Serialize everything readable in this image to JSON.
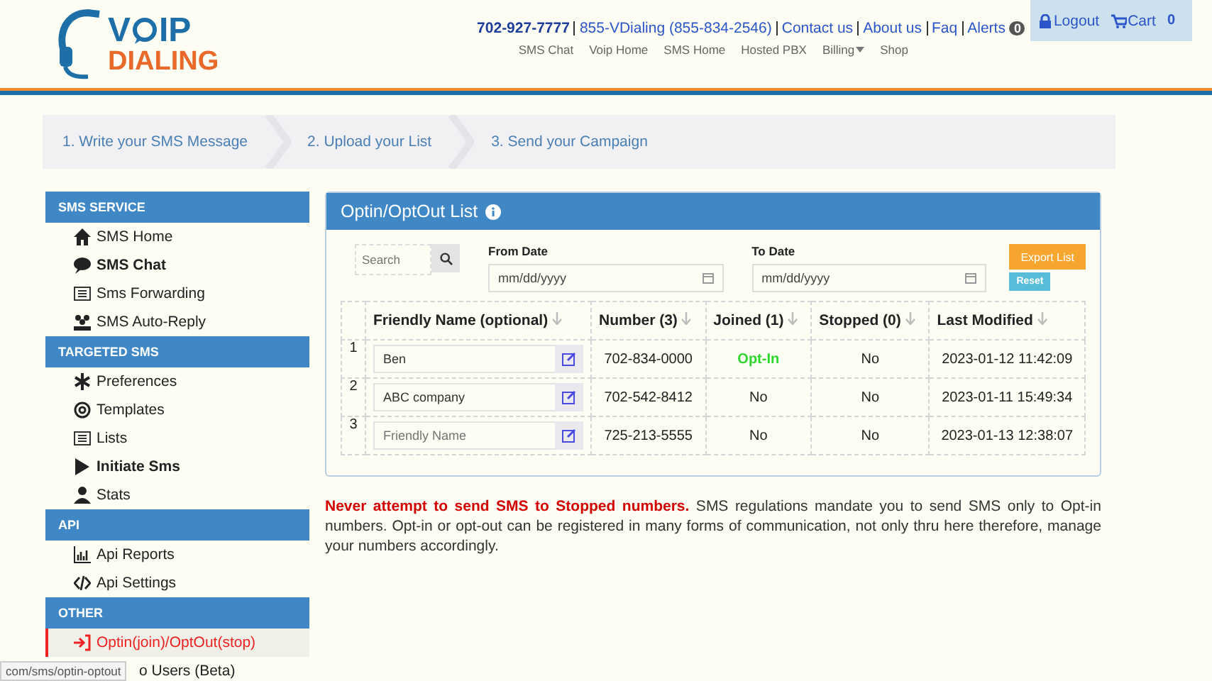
{
  "logo": {
    "line1_start": "V",
    "line1_end": "IP",
    "line2": "DIALING"
  },
  "top_links": {
    "phone": "702-927-7777",
    "items": [
      "855-VDialing (855-834-2546)",
      "Contact us",
      "About us",
      "Faq",
      "Alerts"
    ],
    "alerts_count": "0"
  },
  "account": {
    "logout": "Logout",
    "cart": "Cart",
    "cart_count": "0"
  },
  "nav": [
    "SMS Chat",
    "Voip Home",
    "SMS Home",
    "Hosted PBX",
    "Billing",
    "Shop"
  ],
  "steps": [
    "1. Write your SMS Message",
    "2. Upload your List",
    "3. Send your Campaign"
  ],
  "sidebar": [
    {
      "heading": "SMS SERVICE",
      "items": [
        {
          "label": "SMS Home",
          "bold": false,
          "selected": false
        },
        {
          "label": "SMS Chat",
          "bold": true,
          "selected": false
        },
        {
          "label": "Sms Forwarding",
          "bold": false,
          "selected": false
        },
        {
          "label": "SMS Auto-Reply",
          "bold": false,
          "selected": false
        }
      ]
    },
    {
      "heading": "TARGETED SMS",
      "items": [
        {
          "label": "Preferences",
          "bold": false,
          "selected": false
        },
        {
          "label": "Templates",
          "bold": false,
          "selected": false
        },
        {
          "label": "Lists",
          "bold": false,
          "selected": false
        },
        {
          "label": "Initiate Sms",
          "bold": true,
          "selected": false
        },
        {
          "label": "Stats",
          "bold": false,
          "selected": false
        }
      ]
    },
    {
      "heading": "API",
      "items": [
        {
          "label": "Api Reports",
          "bold": false,
          "selected": false
        },
        {
          "label": "Api Settings",
          "bold": false,
          "selected": false
        }
      ]
    },
    {
      "heading": "OTHER",
      "items": [
        {
          "label": "Optin(join)/OptOut(stop)",
          "bold": false,
          "selected": true
        },
        {
          "label": "o Users (Beta)",
          "bold": false,
          "selected": false
        }
      ]
    }
  ],
  "status_url": "com/sms/optin-optout",
  "panel": {
    "title": "Optin/OptOut List",
    "search": {
      "placeholder": "Search"
    },
    "from_date": {
      "label": "From Date",
      "placeholder": "mm/dd/yyyy"
    },
    "to_date": {
      "label": "To Date",
      "placeholder": "mm/dd/yyyy"
    },
    "buttons": {
      "export": "Export List",
      "reset": "Reset"
    },
    "table": {
      "columns": [
        "Friendly Name (optional)",
        "Number (3)",
        "Joined (1)",
        "Stopped (0)",
        "Last Modified"
      ],
      "rows": [
        {
          "index": "1",
          "name": "Ben",
          "name_placeholder": "",
          "number": "702-834-0000",
          "joined": "Opt-In",
          "opted_in": true,
          "stopped": "No",
          "modified": "2023-01-12 11:42:09"
        },
        {
          "index": "2",
          "name": "ABC company",
          "name_placeholder": "",
          "number": "702-542-8412",
          "joined": "No",
          "opted_in": false,
          "stopped": "No",
          "modified": "2023-01-11 15:49:34"
        },
        {
          "index": "3",
          "name": "",
          "name_placeholder": "Friendly Name",
          "number": "725-213-5555",
          "joined": "No",
          "opted_in": false,
          "stopped": "No",
          "modified": "2023-01-13 12:38:07"
        }
      ]
    }
  },
  "note": "**Never attempt to send SMS to Stopped numbers.** SMS regulations mandate you to send SMS only to Opt-in numbers. Opt-in or opt-out can be registered in many forms of communication, not only thru here therefore, manage your numbers accordingly."
}
